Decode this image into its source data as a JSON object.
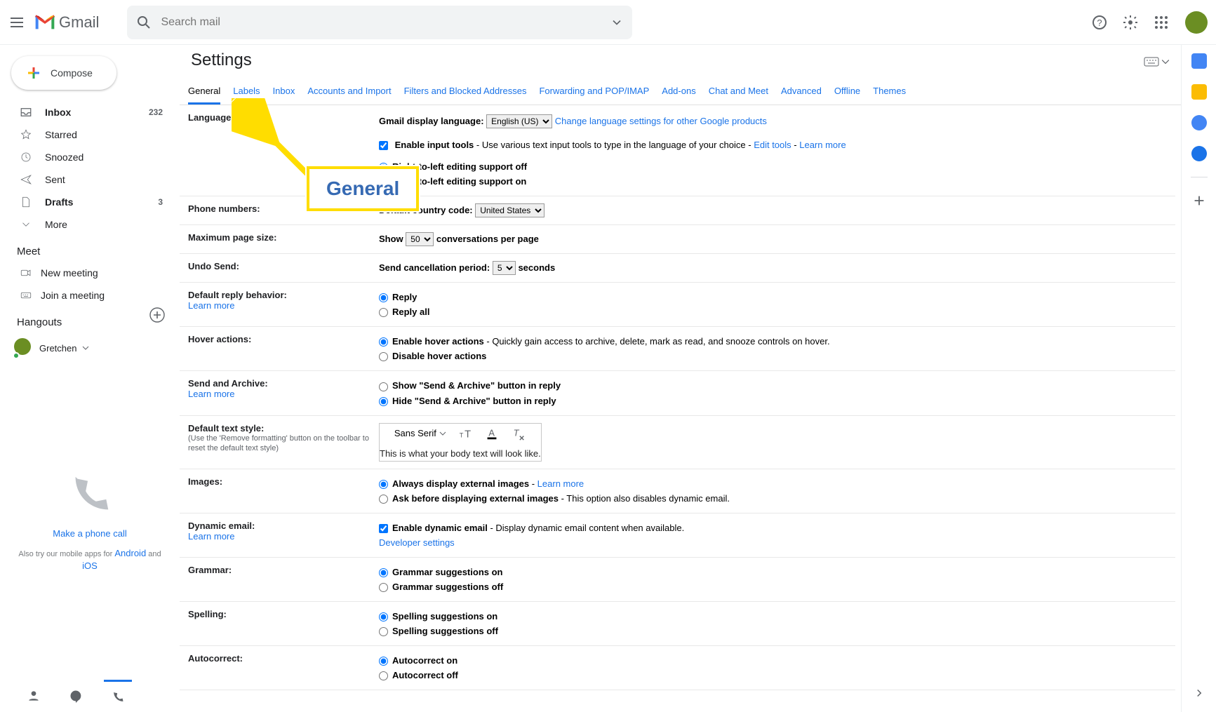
{
  "search": {
    "placeholder": "Search mail"
  },
  "sidebar": {
    "compose": "Compose",
    "items": [
      {
        "label": "Inbox",
        "count": "232",
        "bold": true,
        "icon": "inbox"
      },
      {
        "label": "Starred",
        "count": "",
        "bold": false,
        "icon": "star"
      },
      {
        "label": "Snoozed",
        "count": "",
        "bold": false,
        "icon": "clock"
      },
      {
        "label": "Sent",
        "count": "",
        "bold": false,
        "icon": "send"
      },
      {
        "label": "Drafts",
        "count": "3",
        "bold": true,
        "icon": "file"
      },
      {
        "label": "More",
        "count": "",
        "bold": false,
        "icon": "chevron-down"
      }
    ],
    "meet": {
      "header": "Meet",
      "items": [
        {
          "label": "New meeting",
          "icon": "video"
        },
        {
          "label": "Join a meeting",
          "icon": "keyboard"
        }
      ]
    },
    "hangouts": {
      "header": "Hangouts",
      "name": "Gretchen"
    },
    "phone": {
      "cta": "Make a phone call"
    },
    "apps_note": {
      "prefix": "Also try our mobile apps for ",
      "android": "Android",
      "and": " and ",
      "ios": "iOS"
    }
  },
  "logo": {
    "text": "Gmail"
  },
  "settings_title": "Settings",
  "tabs": [
    "General",
    "Labels",
    "Inbox",
    "Accounts and Import",
    "Filters and Blocked Addresses",
    "Forwarding and POP/IMAP",
    "Add-ons",
    "Chat and Meet",
    "Advanced",
    "Offline",
    "Themes"
  ],
  "callout": "General",
  "lang_row": {
    "label": "Language:",
    "gmail_lang_label": "Gmail display language:",
    "select_value": "English (US)",
    "change_link": "Change language settings for other Google products",
    "enable_tools": "Enable input tools",
    "enable_tools_tail": " - Use various text input tools to type in the language of your choice - ",
    "edit_tools": "Edit tools",
    "sep": " - ",
    "learn_more": "Learn more",
    "rtl_off": "Right-to-left editing support off",
    "rtl_on": "Right-to-left editing support on"
  },
  "phone_row": {
    "label": "Phone numbers:",
    "country_label": "Default country code:",
    "country_value": "United States"
  },
  "page_row": {
    "label": "Maximum page size:",
    "show": "Show",
    "select_value": "50",
    "per_page": "conversations per page"
  },
  "undo_row": {
    "label": "Undo Send:",
    "period_label": "Send cancellation period:",
    "select_value": "5",
    "seconds": "seconds"
  },
  "reply_row": {
    "label": "Default reply behavior:",
    "learn_more": "Learn more",
    "reply": "Reply",
    "reply_all": "Reply all"
  },
  "hover_row": {
    "label": "Hover actions:",
    "enable": "Enable hover actions",
    "enable_tail": " - Quickly gain access to archive, delete, mark as read, and snooze controls on hover.",
    "disable": "Disable hover actions"
  },
  "archive_row": {
    "label": "Send and Archive:",
    "learn_more": "Learn more",
    "show": "Show \"Send & Archive\" button in reply",
    "hide": "Hide \"Send & Archive\" button in reply"
  },
  "textstyle_row": {
    "label": "Default text style:",
    "hint": "(Use the 'Remove formatting' button on the toolbar to reset the default text style)",
    "font": "Sans Serif",
    "sample": "This is what your body text will look like."
  },
  "images_row": {
    "label": "Images:",
    "always": "Always display external images",
    "sep": " - ",
    "learn_more": "Learn more",
    "ask": "Ask before displaying external images",
    "ask_tail": " - This option also disables dynamic email."
  },
  "dyn_row": {
    "label": "Dynamic email:",
    "learn_more": "Learn more",
    "enable": "Enable dynamic email",
    "enable_tail": " - Display dynamic email content when available.",
    "dev": "Developer settings"
  },
  "grammar_row": {
    "label": "Grammar:",
    "on": "Grammar suggestions on",
    "off": "Grammar suggestions off"
  },
  "spelling_row": {
    "label": "Spelling:",
    "on": "Spelling suggestions on",
    "off": "Spelling suggestions off"
  },
  "autoc_row": {
    "label": "Autocorrect:",
    "on": "Autocorrect on",
    "off": "Autocorrect off"
  }
}
